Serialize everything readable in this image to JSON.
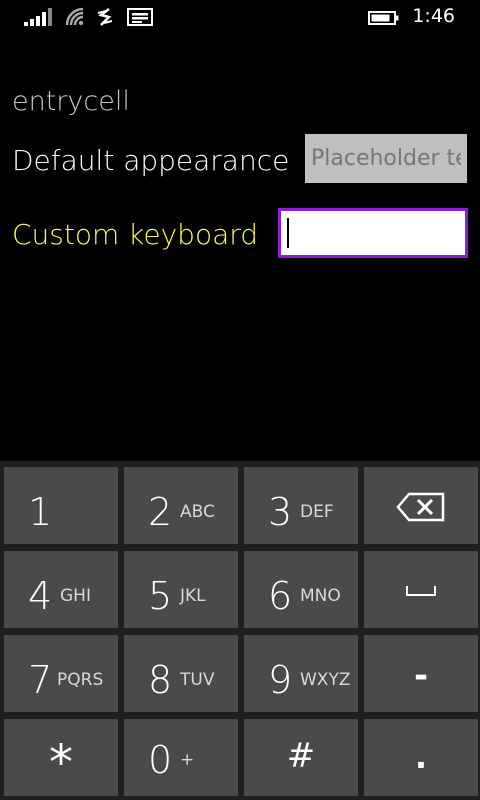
{
  "status_bar": {
    "time": "1:46",
    "icons": [
      "signal-icon",
      "wifi-icon",
      "data-icon",
      "message-icon",
      "battery-icon"
    ]
  },
  "page": {
    "title": "entrycell",
    "rows": [
      {
        "label": "Default appearance",
        "placeholder": "Placeholder text",
        "value": ""
      },
      {
        "label": "Custom keyboard",
        "placeholder": "",
        "value": ""
      }
    ]
  },
  "colors": {
    "background": "#000000",
    "custom_label": "#ffff3c",
    "focus_border": "#8a1fd6",
    "key": "#4a4a4a",
    "keyboard_bg": "#1f1f1f"
  },
  "keyboard": {
    "keys": [
      {
        "digit": "1",
        "letters": ""
      },
      {
        "digit": "2",
        "letters": "ABC"
      },
      {
        "digit": "3",
        "letters": "DEF"
      },
      {
        "symbol_icon": "backspace-icon"
      },
      {
        "digit": "4",
        "letters": "GHI"
      },
      {
        "digit": "5",
        "letters": "JKL"
      },
      {
        "digit": "6",
        "letters": "MNO"
      },
      {
        "symbol_icon": "space-icon"
      },
      {
        "digit": "7",
        "letters": "PQRS"
      },
      {
        "digit": "8",
        "letters": "TUV"
      },
      {
        "digit": "9",
        "letters": "WXYZ"
      },
      {
        "symbol": "-"
      },
      {
        "symbol": "*"
      },
      {
        "digit": "0",
        "letters": "+"
      },
      {
        "symbol": "#"
      },
      {
        "symbol": "."
      }
    ]
  }
}
